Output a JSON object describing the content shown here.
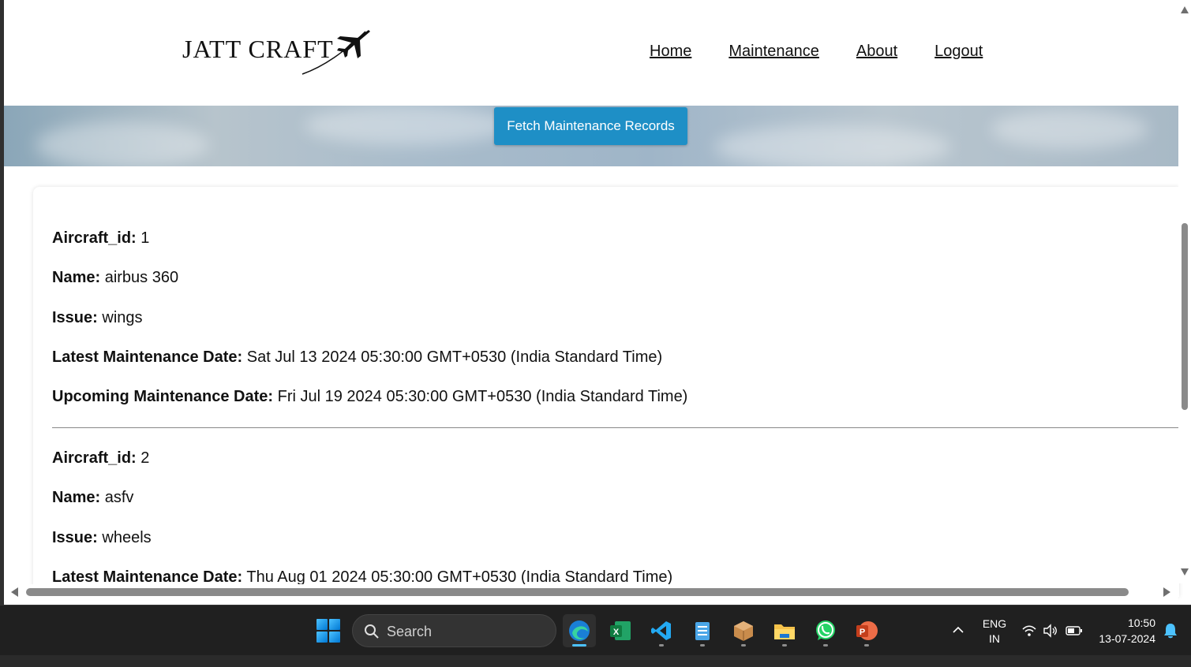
{
  "brand": {
    "name": "JATT CRAFT"
  },
  "nav": [
    {
      "label": "Home"
    },
    {
      "label": "Maintenance"
    },
    {
      "label": "About"
    },
    {
      "label": "Logout"
    }
  ],
  "actions": {
    "fetch_label": "Fetch Maintenance Records"
  },
  "records": [
    {
      "aircraft_id_label": "Aircraft_id:",
      "aircraft_id": "1",
      "name_label": "Name:",
      "name": "airbus 360",
      "issue_label": "Issue:",
      "issue": "wings",
      "latest_label": "Latest Maintenance Date:",
      "latest": "Sat Jul 13 2024 05:30:00 GMT+0530 (India Standard Time)",
      "upcoming_label": "Upcoming Maintenance Date:",
      "upcoming": "Fri Jul 19 2024 05:30:00 GMT+0530 (India Standard Time)"
    },
    {
      "aircraft_id_label": "Aircraft_id:",
      "aircraft_id": "2",
      "name_label": "Name:",
      "name": "asfv",
      "issue_label": "Issue:",
      "issue": "wheels",
      "latest_label": "Latest Maintenance Date:",
      "latest": "Thu Aug 01 2024 05:30:00 GMT+0530 (India Standard Time)"
    }
  ],
  "taskbar": {
    "search_placeholder": "Search",
    "apps": [
      "edge-icon",
      "excel-icon",
      "vscode-icon",
      "notepad-icon",
      "package-icon",
      "file-explorer-icon",
      "whatsapp-icon",
      "powerpoint-icon"
    ],
    "lang_primary": "ENG",
    "lang_secondary": "IN",
    "time": "10:50",
    "date": "13-07-2024"
  },
  "colors": {
    "button": "#1e8fc6",
    "taskbar": "#202020",
    "accent": "#4cc2ff"
  }
}
